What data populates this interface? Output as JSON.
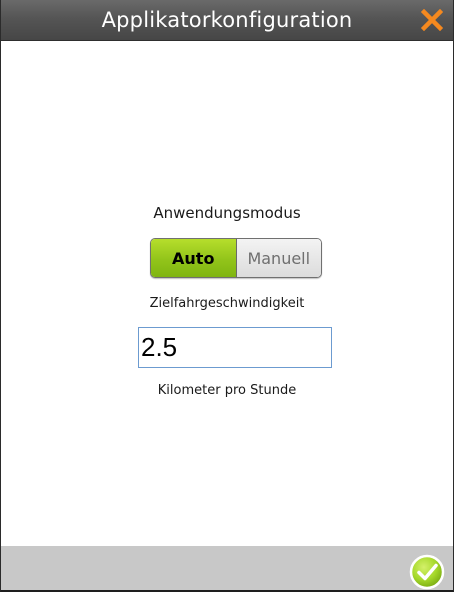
{
  "titlebar": {
    "title": "Applikatorkonfiguration",
    "close_icon": "close-icon",
    "close_color": "#f5891f"
  },
  "mode": {
    "label": "Anwendungsmodus",
    "options": [
      "Auto",
      "Manuell"
    ],
    "selected": "Auto",
    "active_color": "#8fc31a"
  },
  "speed": {
    "label": "Zielfahrgeschwindigkeit",
    "value": "2.5",
    "unit": "Kilometer pro Stunde"
  },
  "footer": {
    "confirm_icon": "checkmark-circle-icon",
    "confirm_color": "#a6d92b"
  }
}
